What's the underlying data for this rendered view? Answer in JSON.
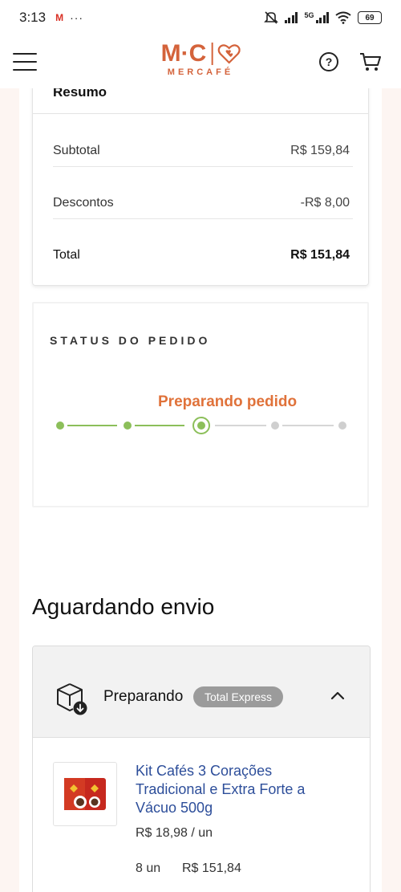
{
  "status_bar": {
    "time": "3:13",
    "gmail_icon": "M",
    "more": "···",
    "network": "5G",
    "battery": "69"
  },
  "header": {
    "logo_mark_left": "M·C",
    "logo_wordmark": "MERCAFÉ",
    "help_label": "?",
    "brand_color": "#d4633b"
  },
  "resumo": {
    "title": "Resumo",
    "rows": [
      {
        "label": "Subtotal",
        "value": "R$ 159,84"
      },
      {
        "label": "Descontos",
        "value": "-R$ 8,00"
      },
      {
        "label": "Total",
        "value": "R$ 151,84"
      }
    ]
  },
  "status": {
    "title": "STATUS DO PEDIDO",
    "current_label": "Preparando pedido",
    "steps_total": 5,
    "current_step": 3,
    "colors": {
      "done": "#8cbf5a",
      "todo": "#cfcfcf",
      "current_text": "#e0723a"
    }
  },
  "shipments_section": {
    "title": "Aguardando envio"
  },
  "shipment": {
    "status_label": "Preparando",
    "carrier_badge": "Total Express",
    "expanded": true,
    "product": {
      "name": "Kit Cafés 3 Corações Tradicional e Extra Forte a Vácuo 500g",
      "unit_price": "R$ 18,98 / un",
      "quantity": "8 un",
      "total": "R$ 151,84"
    }
  }
}
